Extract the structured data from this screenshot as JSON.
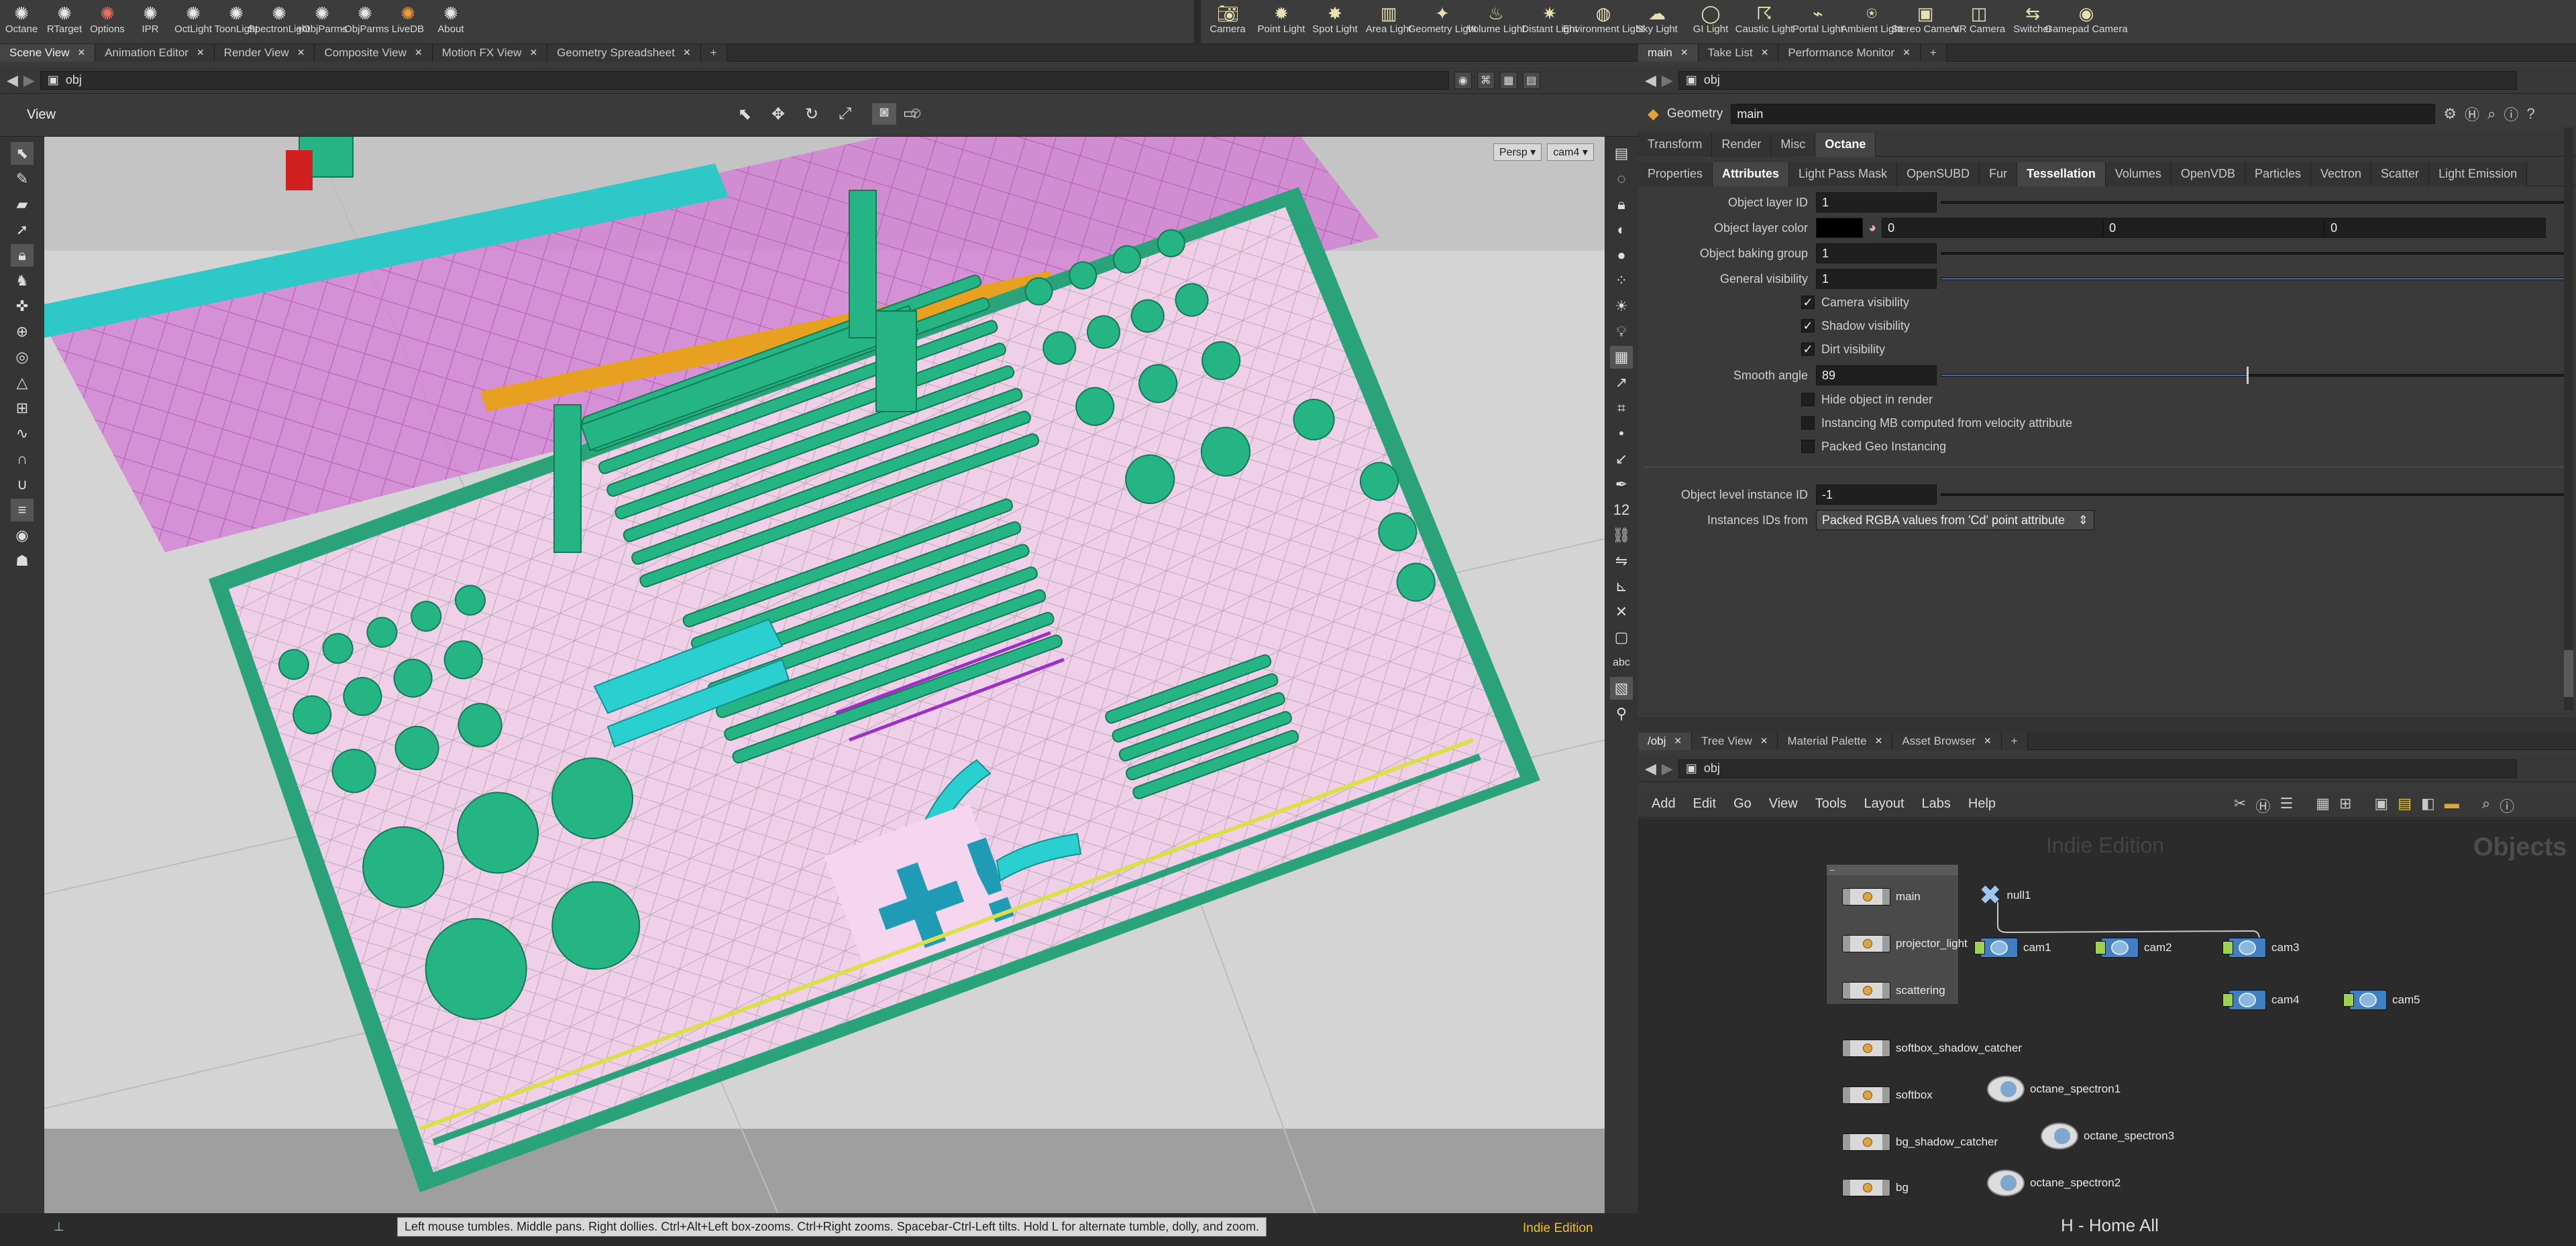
{
  "shelf_left": [
    {
      "icon": "octane-icon",
      "label": "Octane"
    },
    {
      "icon": "rtarget-icon",
      "label": "RTarget"
    },
    {
      "icon": "options-icon",
      "label": "Options"
    },
    {
      "icon": "ipr-icon",
      "label": "IPR"
    },
    {
      "icon": "octlight-icon",
      "label": "OctLight"
    },
    {
      "icon": "toonlight-icon",
      "label": "ToonLight"
    },
    {
      "icon": "spectronlight-icon",
      "label": "SpectronLight"
    },
    {
      "icon": "objparams-add-icon",
      "label": "+ObjParms"
    },
    {
      "icon": "objparams-remove-icon",
      "label": "-ObjParms"
    },
    {
      "icon": "livedb-icon",
      "label": "LiveDB"
    },
    {
      "icon": "about-icon",
      "label": "About"
    }
  ],
  "shelf_right": [
    {
      "icon": "camera-icon",
      "label": "Camera"
    },
    {
      "icon": "point-light-icon",
      "label": "Point Light"
    },
    {
      "icon": "spot-light-icon",
      "label": "Spot Light"
    },
    {
      "icon": "area-light-icon",
      "label": "Area Light"
    },
    {
      "icon": "geometry-light-icon",
      "label": "Geometry Light"
    },
    {
      "icon": "volume-light-icon",
      "label": "Volume Light"
    },
    {
      "icon": "distant-light-icon",
      "label": "Distant Light"
    },
    {
      "icon": "environment-light-icon",
      "label": "Environment Light"
    },
    {
      "icon": "sky-light-icon",
      "label": "Sky Light"
    },
    {
      "icon": "gi-light-icon",
      "label": "GI Light"
    },
    {
      "icon": "caustic-light-icon",
      "label": "Caustic Light"
    },
    {
      "icon": "portal-light-icon",
      "label": "Portal Light"
    },
    {
      "icon": "ambient-light-icon",
      "label": "Ambient Light"
    },
    {
      "icon": "stereo-camera-icon",
      "label": "Stereo Camera"
    },
    {
      "icon": "vr-camera-icon",
      "label": "VR Camera"
    },
    {
      "icon": "switcher-icon",
      "label": "Switcher"
    },
    {
      "icon": "gamepad-camera-icon",
      "label": "Gamepad Camera"
    }
  ],
  "left_tabs": [
    "Scene View",
    "Animation Editor",
    "Render View",
    "Composite View",
    "Motion FX View",
    "Geometry Spreadsheet"
  ],
  "left_path": "obj",
  "viewport": {
    "title": "View",
    "persp": "Persp",
    "cam": "cam4",
    "hint": "Left mouse tumbles. Middle pans. Right dollies. Ctrl+Alt+Left box-zooms. Ctrl+Right zooms. Spacebar-Ctrl-Left tilts. Hold L for alternate tumble, dolly, and zoom.",
    "edition": "Indie Edition"
  },
  "right_tabs": [
    "main",
    "Take List",
    "Performance Monitor"
  ],
  "param_path": "obj",
  "params": {
    "type": "Geometry",
    "name": "main",
    "tabs_top": [
      "Transform",
      "Render",
      "Misc",
      "Octane"
    ],
    "tabs_sub": [
      "Properties",
      "Attributes",
      "Light Pass Mask",
      "OpenSUBD",
      "Fur",
      "Tessellation",
      "Volumes",
      "OpenVDB",
      "Particles",
      "Vectron",
      "Scatter",
      "Light Emission"
    ],
    "object_layer_id_label": "Object layer ID",
    "object_layer_id": "1",
    "object_layer_color_label": "Object layer color",
    "color_r": "0",
    "color_g": "0",
    "color_b": "0",
    "object_baking_group_label": "Object baking group",
    "object_baking_group": "1",
    "general_visibility_label": "General visibility",
    "general_visibility": "1",
    "camera_visibility": "Camera visibility",
    "shadow_visibility": "Shadow visibility",
    "dirt_visibility": "Dirt visibility",
    "smooth_angle_label": "Smooth angle",
    "smooth_angle": "89",
    "hide_object": "Hide object in render",
    "instancing_mb": "Instancing MB computed from velocity attribute",
    "packed_geo": "Packed Geo Instancing",
    "instance_id_label": "Object level instance ID",
    "instance_id": "-1",
    "instances_from_label": "Instances IDs from",
    "instances_from": "Packed RGBA values from 'Cd' point attribute"
  },
  "net_tabs": [
    "/obj",
    "Tree View",
    "Material Palette",
    "Asset Browser"
  ],
  "net_path": "obj",
  "net_menu": [
    "Add",
    "Edit",
    "Go",
    "View",
    "Tools",
    "Layout",
    "Labs",
    "Help"
  ],
  "network": {
    "watermark": "Indie Edition",
    "context": "Objects",
    "footer": "H - Home All",
    "geo_nodes": [
      "main",
      "projector_light",
      "scattering",
      "softbox_shadow_catcher",
      "softbox",
      "bg_shadow_catcher",
      "bg"
    ],
    "null_node": "null1",
    "cams": [
      "cam1",
      "cam2",
      "cam3",
      "cam4",
      "cam5"
    ],
    "spectrons": [
      "octane_spectron1",
      "octane_spectron3",
      "octane_spectron2"
    ]
  }
}
